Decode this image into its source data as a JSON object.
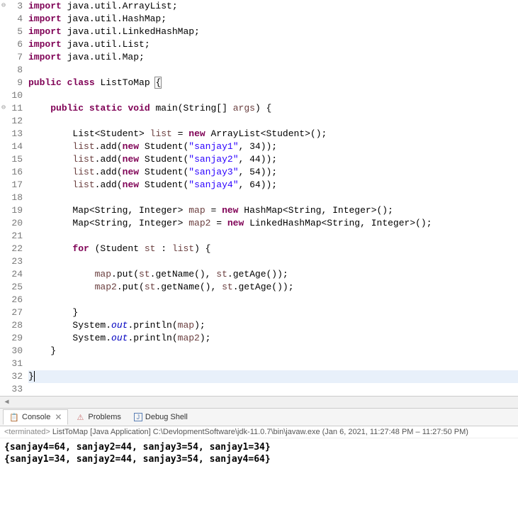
{
  "code": {
    "lines": [
      {
        "n": 3,
        "marker": "⊖",
        "tokens": [
          {
            "t": "kw",
            "v": "import"
          },
          {
            "t": "punct",
            "v": " java.util.ArrayList;"
          }
        ]
      },
      {
        "n": 4,
        "tokens": [
          {
            "t": "kw",
            "v": "import"
          },
          {
            "t": "punct",
            "v": " java.util.HashMap;"
          }
        ]
      },
      {
        "n": 5,
        "tokens": [
          {
            "t": "kw",
            "v": "import"
          },
          {
            "t": "punct",
            "v": " java.util.LinkedHashMap;"
          }
        ]
      },
      {
        "n": 6,
        "tokens": [
          {
            "t": "kw",
            "v": "import"
          },
          {
            "t": "punct",
            "v": " java.util.List;"
          }
        ]
      },
      {
        "n": 7,
        "tokens": [
          {
            "t": "kw",
            "v": "import"
          },
          {
            "t": "punct",
            "v": " java.util.Map;"
          }
        ]
      },
      {
        "n": 8,
        "tokens": []
      },
      {
        "n": 9,
        "tokens": [
          {
            "t": "kw",
            "v": "public"
          },
          {
            "t": "punct",
            "v": " "
          },
          {
            "t": "kw",
            "v": "class"
          },
          {
            "t": "punct",
            "v": " ListToMap "
          },
          {
            "t": "punct",
            "v": "{"
          }
        ],
        "boxed": true
      },
      {
        "n": 10,
        "tokens": []
      },
      {
        "n": 11,
        "marker": "⊖",
        "indent": 1,
        "tokens": [
          {
            "t": "kw",
            "v": "public"
          },
          {
            "t": "punct",
            "v": " "
          },
          {
            "t": "kw",
            "v": "static"
          },
          {
            "t": "punct",
            "v": " "
          },
          {
            "t": "kw",
            "v": "void"
          },
          {
            "t": "punct",
            "v": " main(String[] "
          },
          {
            "t": "var",
            "v": "args"
          },
          {
            "t": "punct",
            "v": ") {"
          }
        ]
      },
      {
        "n": 12,
        "tokens": []
      },
      {
        "n": 13,
        "indent": 2,
        "tokens": [
          {
            "t": "punct",
            "v": "List<Student> "
          },
          {
            "t": "var",
            "v": "list"
          },
          {
            "t": "punct",
            "v": " = "
          },
          {
            "t": "kw",
            "v": "new"
          },
          {
            "t": "punct",
            "v": " ArrayList<Student>();"
          }
        ]
      },
      {
        "n": 14,
        "indent": 2,
        "tokens": [
          {
            "t": "var",
            "v": "list"
          },
          {
            "t": "punct",
            "v": ".add("
          },
          {
            "t": "kw",
            "v": "new"
          },
          {
            "t": "punct",
            "v": " Student("
          },
          {
            "t": "str",
            "v": "\"sanjay1\""
          },
          {
            "t": "punct",
            "v": ", 34));"
          }
        ]
      },
      {
        "n": 15,
        "indent": 2,
        "tokens": [
          {
            "t": "var",
            "v": "list"
          },
          {
            "t": "punct",
            "v": ".add("
          },
          {
            "t": "kw",
            "v": "new"
          },
          {
            "t": "punct",
            "v": " Student("
          },
          {
            "t": "str",
            "v": "\"sanjay2\""
          },
          {
            "t": "punct",
            "v": ", 44));"
          }
        ]
      },
      {
        "n": 16,
        "indent": 2,
        "tokens": [
          {
            "t": "var",
            "v": "list"
          },
          {
            "t": "punct",
            "v": ".add("
          },
          {
            "t": "kw",
            "v": "new"
          },
          {
            "t": "punct",
            "v": " Student("
          },
          {
            "t": "str",
            "v": "\"sanjay3\""
          },
          {
            "t": "punct",
            "v": ", 54));"
          }
        ]
      },
      {
        "n": 17,
        "indent": 2,
        "tokens": [
          {
            "t": "var",
            "v": "list"
          },
          {
            "t": "punct",
            "v": ".add("
          },
          {
            "t": "kw",
            "v": "new"
          },
          {
            "t": "punct",
            "v": " Student("
          },
          {
            "t": "str",
            "v": "\"sanjay4\""
          },
          {
            "t": "punct",
            "v": ", 64));"
          }
        ]
      },
      {
        "n": 18,
        "tokens": []
      },
      {
        "n": 19,
        "indent": 2,
        "tokens": [
          {
            "t": "punct",
            "v": "Map<String, Integer> "
          },
          {
            "t": "var",
            "v": "map"
          },
          {
            "t": "punct",
            "v": " = "
          },
          {
            "t": "kw",
            "v": "new"
          },
          {
            "t": "punct",
            "v": " HashMap<String, Integer>();"
          }
        ]
      },
      {
        "n": 20,
        "indent": 2,
        "tokens": [
          {
            "t": "punct",
            "v": "Map<String, Integer> "
          },
          {
            "t": "var",
            "v": "map2"
          },
          {
            "t": "punct",
            "v": " = "
          },
          {
            "t": "kw",
            "v": "new"
          },
          {
            "t": "punct",
            "v": " LinkedHashMap<String, Integer>();"
          }
        ]
      },
      {
        "n": 21,
        "tokens": []
      },
      {
        "n": 22,
        "indent": 2,
        "tokens": [
          {
            "t": "kw",
            "v": "for"
          },
          {
            "t": "punct",
            "v": " (Student "
          },
          {
            "t": "var",
            "v": "st"
          },
          {
            "t": "punct",
            "v": " : "
          },
          {
            "t": "var",
            "v": "list"
          },
          {
            "t": "punct",
            "v": ") {"
          }
        ]
      },
      {
        "n": 23,
        "tokens": []
      },
      {
        "n": 24,
        "indent": 3,
        "tokens": [
          {
            "t": "var",
            "v": "map"
          },
          {
            "t": "punct",
            "v": ".put("
          },
          {
            "t": "var",
            "v": "st"
          },
          {
            "t": "punct",
            "v": ".getName(), "
          },
          {
            "t": "var",
            "v": "st"
          },
          {
            "t": "punct",
            "v": ".getAge());"
          }
        ]
      },
      {
        "n": 25,
        "indent": 3,
        "tokens": [
          {
            "t": "var",
            "v": "map2"
          },
          {
            "t": "punct",
            "v": ".put("
          },
          {
            "t": "var",
            "v": "st"
          },
          {
            "t": "punct",
            "v": ".getName(), "
          },
          {
            "t": "var",
            "v": "st"
          },
          {
            "t": "punct",
            "v": ".getAge());"
          }
        ]
      },
      {
        "n": 26,
        "tokens": []
      },
      {
        "n": 27,
        "indent": 2,
        "tokens": [
          {
            "t": "punct",
            "v": "}"
          }
        ]
      },
      {
        "n": 28,
        "indent": 2,
        "tokens": [
          {
            "t": "punct",
            "v": "System."
          },
          {
            "t": "field",
            "v": "out"
          },
          {
            "t": "punct",
            "v": ".println("
          },
          {
            "t": "var",
            "v": "map"
          },
          {
            "t": "punct",
            "v": ");"
          }
        ]
      },
      {
        "n": 29,
        "indent": 2,
        "tokens": [
          {
            "t": "punct",
            "v": "System."
          },
          {
            "t": "field",
            "v": "out"
          },
          {
            "t": "punct",
            "v": ".println("
          },
          {
            "t": "var",
            "v": "map2"
          },
          {
            "t": "punct",
            "v": ");"
          }
        ]
      },
      {
        "n": 30,
        "indent": 1,
        "tokens": [
          {
            "t": "punct",
            "v": "}"
          }
        ]
      },
      {
        "n": 31,
        "tokens": []
      },
      {
        "n": 32,
        "highlight": true,
        "cursor": true,
        "tokens": [
          {
            "t": "punct",
            "v": "}"
          }
        ]
      },
      {
        "n": 33,
        "tokens": []
      }
    ]
  },
  "tabs": {
    "console": {
      "label": "Console",
      "icon": "📋"
    },
    "problems": {
      "label": "Problems",
      "icon": "⚠"
    },
    "debugShell": {
      "label": "Debug Shell",
      "icon": "J"
    }
  },
  "consoleHeader": {
    "status": "<terminated>",
    "app": "ListToMap [Java Application]",
    "path": "C:\\DevlopmentSoftware\\jdk-11.0.7\\bin\\javaw.exe",
    "time": "(Jan 6, 2021, 11:27:48 PM – 11:27:50 PM)"
  },
  "consoleOutput": [
    "{sanjay4=64, sanjay2=44, sanjay3=54, sanjay1=34}",
    "{sanjay1=34, sanjay2=44, sanjay3=54, sanjay4=64}"
  ]
}
